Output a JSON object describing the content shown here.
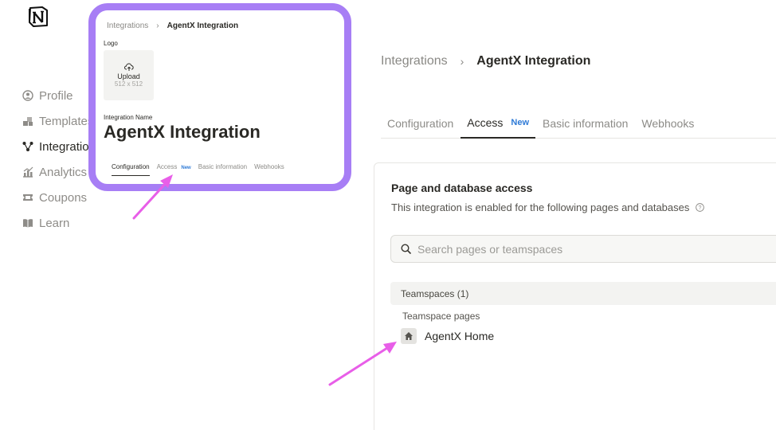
{
  "sidebar": {
    "items": [
      {
        "label": "Profile",
        "icon": "user-circle-icon"
      },
      {
        "label": "Templates",
        "icon": "template-icon"
      },
      {
        "label": "Integrations",
        "icon": "graph-nodes-icon"
      },
      {
        "label": "Analytics",
        "icon": "chart-icon"
      },
      {
        "label": "Coupons",
        "icon": "ticket-icon"
      },
      {
        "label": "Learn",
        "icon": "book-icon"
      }
    ],
    "active": "Integrations"
  },
  "breadcrumb": {
    "parent": "Integrations",
    "separator": "›",
    "current": "AgentX Integration"
  },
  "tabs": [
    {
      "label": "Configuration"
    },
    {
      "label": "Access",
      "badge": "New"
    },
    {
      "label": "Basic information"
    },
    {
      "label": "Webhooks"
    }
  ],
  "access": {
    "title": "Page and database access",
    "subtitle": "This integration is enabled for the following pages and databases",
    "search_placeholder": "Search pages or teamspaces",
    "teamspaces_header": "Teamspaces (1)",
    "teamspace_pages_label": "Teamspace pages",
    "pages": [
      {
        "name": "AgentX Home",
        "icon": "home-icon"
      }
    ]
  },
  "callout": {
    "breadcrumb_parent": "Integrations",
    "breadcrumb_separator": "›",
    "breadcrumb_current": "AgentX Integration",
    "logo_label": "Logo",
    "upload_label": "Upload",
    "upload_size": "512 x 512",
    "name_label": "Integration Name",
    "name": "AgentX Integration",
    "tabs": [
      "Configuration",
      "Access",
      "Basic information",
      "Webhooks"
    ],
    "badge": "New"
  },
  "colors": {
    "callout_border": "#a77ef5",
    "arrow": "#e85ee8",
    "badge": "#2e7ad6"
  }
}
